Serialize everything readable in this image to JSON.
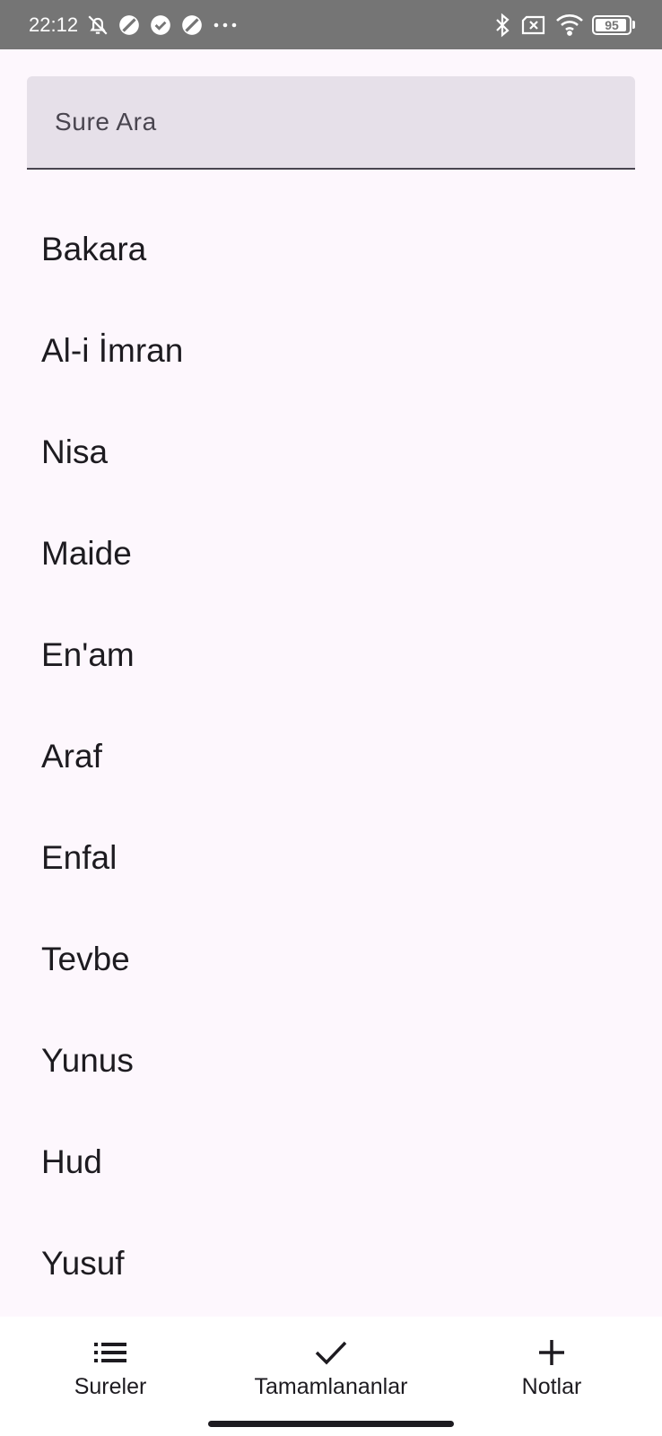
{
  "status_bar": {
    "time": "22:12",
    "left_icons": [
      "bell-off-icon",
      "circle-slash-icon",
      "check-circle-icon",
      "circle-slash-icon",
      "more-dots-icon"
    ],
    "right_icons": [
      "bluetooth-icon",
      "sim-x-icon",
      "wifi-icon"
    ],
    "battery_level": 95,
    "battery_label": "95"
  },
  "search": {
    "placeholder": "Sure Ara",
    "value": ""
  },
  "sure_list": [
    {
      "label": "Bakara"
    },
    {
      "label": "Al-i İmran"
    },
    {
      "label": "Nisa"
    },
    {
      "label": "Maide"
    },
    {
      "label": "En'am"
    },
    {
      "label": "Araf"
    },
    {
      "label": "Enfal"
    },
    {
      "label": "Tevbe"
    },
    {
      "label": "Yunus"
    },
    {
      "label": "Hud"
    },
    {
      "label": "Yusuf"
    }
  ],
  "bottom_nav": {
    "items": [
      {
        "label": "Sureler",
        "icon": "list-icon"
      },
      {
        "label": "Tamamlananlar",
        "icon": "check-icon"
      },
      {
        "label": "Notlar",
        "icon": "plus-icon"
      }
    ]
  },
  "colors": {
    "background": "#fdf7fd",
    "status_bar": "#757575",
    "search_fill": "#e6e0e9",
    "text": "#1d1b20"
  }
}
